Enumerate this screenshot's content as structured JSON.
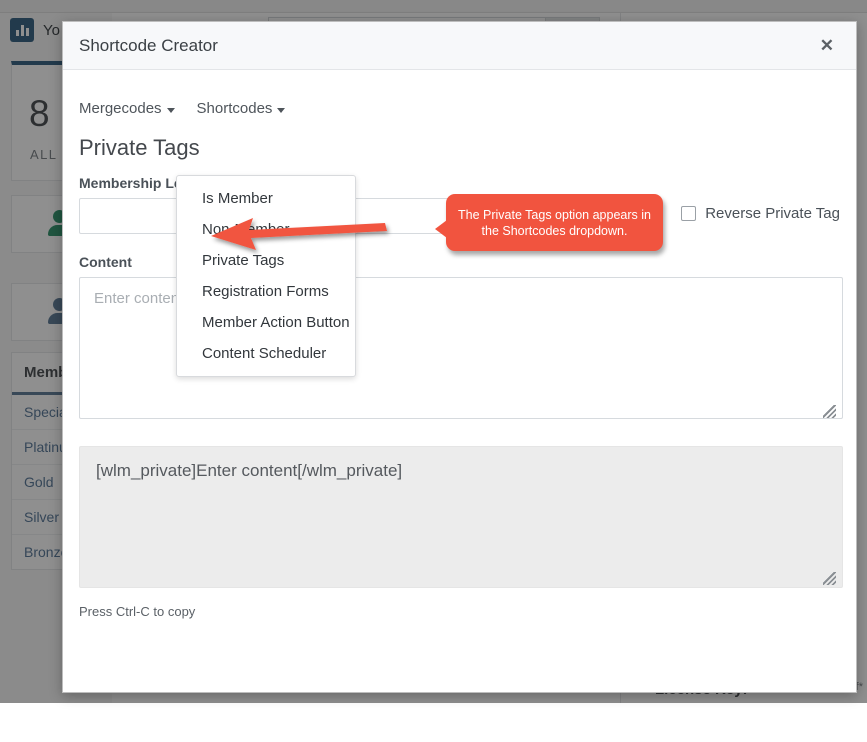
{
  "background": {
    "brand_text": "Yo",
    "brand_icon": "bar-chart-icon",
    "stat_number": "8",
    "stat_label": "ALL USERS",
    "icon_card_1": "user-check-icon",
    "icon_card_2": "user-question-icon",
    "levels_title": "Memb",
    "levels": [
      "Special",
      "Platinum",
      "Gold",
      "Silver",
      "Bronze"
    ],
    "license_label": "License Key:",
    "right_crumb": "f*"
  },
  "modal": {
    "title": "Shortcode Creator",
    "close_icon": "close-icon",
    "menubar": [
      {
        "label": "Mergecodes",
        "icon": "chevron-down-icon"
      },
      {
        "label": "Shortcodes",
        "icon": "chevron-down-icon"
      }
    ],
    "section_title": "Private Tags",
    "membership_level": {
      "label": "Membership Level",
      "value": "",
      "placeholder": ""
    },
    "reverse_checkbox": {
      "label": "Reverse Private Tag",
      "checked": false
    },
    "content": {
      "label": "Content",
      "value": "",
      "placeholder": "Enter content"
    },
    "output": {
      "value": "[wlm_private]Enter content[/wlm_private]"
    },
    "copy_hint": "Press Ctrl-C to copy"
  },
  "dropdown": {
    "open": true,
    "items": [
      "Is Member",
      "Non-Member",
      "Private Tags",
      "Registration Forms",
      "Member Action Button",
      "Content Scheduler"
    ]
  },
  "callout": {
    "text": "The Private Tags option appears in the Shortcodes dropdown.",
    "color": "#f1543f",
    "arrow_target": "Private Tags"
  },
  "colors": {
    "accent_red": "#f1543f",
    "brand_blue": "#1d4e73",
    "green": "#17865a",
    "slate": "#4a6b8a"
  }
}
